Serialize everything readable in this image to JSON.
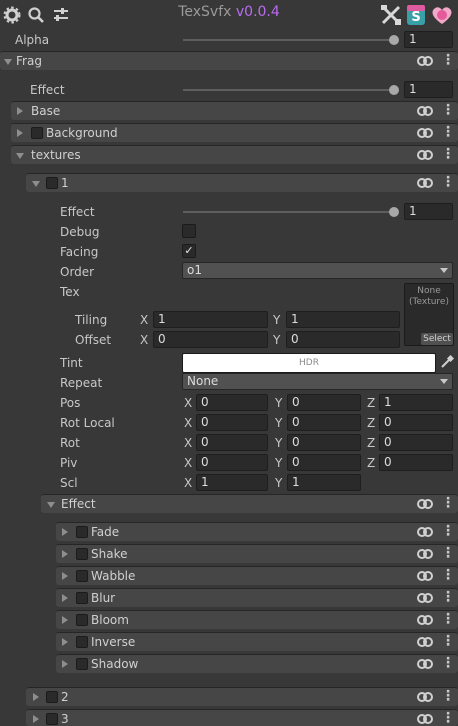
{
  "app": {
    "title": "TexSvfx",
    "version": "v0.0.4"
  },
  "alpha": {
    "label": "Alpha",
    "value": "1",
    "level": 1.0
  },
  "frag": {
    "label": "Frag"
  },
  "effect_top": {
    "label": "Effect",
    "value": "1",
    "level": 1.0
  },
  "base": {
    "label": "Base"
  },
  "background": {
    "label": "Background"
  },
  "textures": {
    "label": "textures"
  },
  "tex1": {
    "label": "1",
    "effect": {
      "label": "Effect",
      "value": "1",
      "level": 1.0
    },
    "debug": {
      "label": "Debug"
    },
    "facing": {
      "label": "Facing",
      "check": "✓"
    },
    "order": {
      "label": "Order",
      "value": "o1"
    },
    "tex": {
      "label": "Tex",
      "none_line1": "None",
      "none_line2": "(Texture)",
      "select": "Select"
    },
    "tiling": {
      "label": "Tiling",
      "x_label": "X",
      "x": "1",
      "y_label": "Y",
      "y": "1"
    },
    "offset": {
      "label": "Offset",
      "x_label": "X",
      "x": "0",
      "y_label": "Y",
      "y": "0"
    },
    "tint": {
      "label": "Tint",
      "hdr": "HDR"
    },
    "repeat": {
      "label": "Repeat",
      "value": "None"
    },
    "pos": {
      "label": "Pos",
      "x": "0",
      "y": "0",
      "z": "1"
    },
    "rotlocal": {
      "label": "Rot Local",
      "x": "0",
      "y": "0",
      "z": "0"
    },
    "rot": {
      "label": "Rot",
      "x": "0",
      "y": "0",
      "z": "0"
    },
    "piv": {
      "label": "Piv",
      "x": "0",
      "y": "0",
      "z": "0"
    },
    "scl": {
      "label": "Scl",
      "x": "1",
      "y": "1"
    },
    "axis": {
      "x": "X",
      "y": "Y",
      "z": "Z"
    },
    "effect_group": {
      "label": "Effect"
    },
    "effects": [
      "Fade",
      "Shake",
      "Wabble",
      "Blur",
      "Bloom",
      "Inverse",
      "Shadow"
    ]
  },
  "tex2": {
    "label": "2"
  },
  "tex3": {
    "label": "3"
  },
  "icons": [
    "gear-icon",
    "search-icon",
    "sliders-icon",
    "tools-icon",
    "s-badge-icon",
    "heart-badge-icon",
    "link-icon",
    "kebab-icon",
    "eyedropper-icon"
  ],
  "colors": {
    "accent": "#b86cf0",
    "header": "#464646",
    "bg": "#383838",
    "field": "#2a2a2a"
  }
}
